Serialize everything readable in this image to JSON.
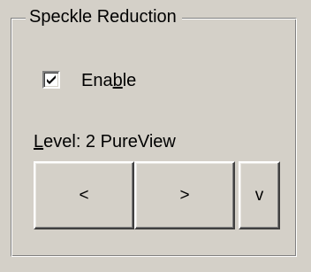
{
  "group": {
    "title": "Speckle Reduction"
  },
  "enable": {
    "label_pre": "Ena",
    "label_mnemonic": "b",
    "label_post": "le",
    "checked": true
  },
  "level": {
    "label_mnemonic": "L",
    "label_post": "evel: 2 PureView"
  },
  "buttons": {
    "prev_label": "<",
    "next_label": ">",
    "down_label": "v"
  }
}
